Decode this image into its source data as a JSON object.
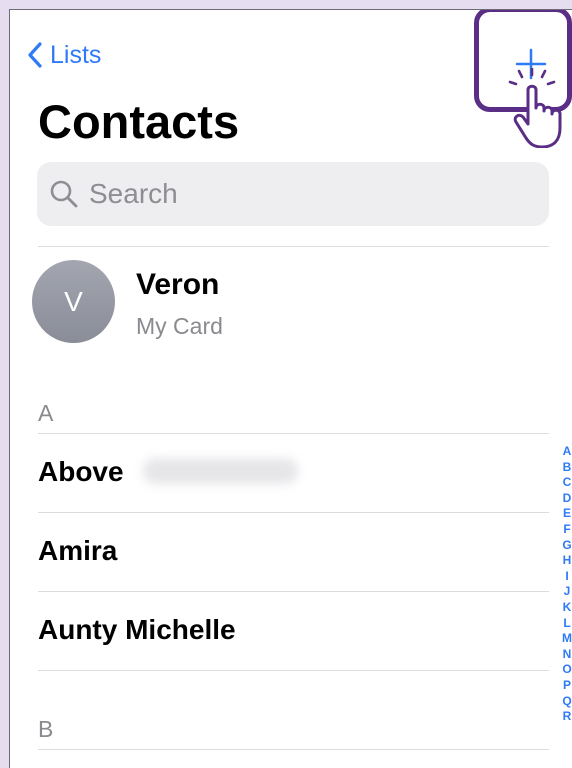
{
  "nav": {
    "back_label": "Lists"
  },
  "header": {
    "title": "Contacts"
  },
  "search": {
    "placeholder": "Search"
  },
  "my_card": {
    "initial": "V",
    "name": "Veron",
    "subtitle": "My Card"
  },
  "sections": [
    {
      "letter": "A",
      "contacts": [
        "Above",
        "Amira",
        "Aunty Michelle"
      ]
    },
    {
      "letter": "B",
      "contacts": []
    }
  ],
  "index_letters": [
    "A",
    "B",
    "C",
    "D",
    "E",
    "F",
    "G",
    "H",
    "I",
    "J",
    "K",
    "L",
    "M",
    "N",
    "O",
    "P",
    "Q",
    "R"
  ],
  "colors": {
    "accent": "#2f7af6",
    "highlight": "#5a2d86",
    "background": "#e6def0"
  },
  "icons": {
    "back": "chevron-left-icon",
    "add": "plus-icon",
    "search": "search-icon",
    "hand": "hand-pointer-icon"
  }
}
